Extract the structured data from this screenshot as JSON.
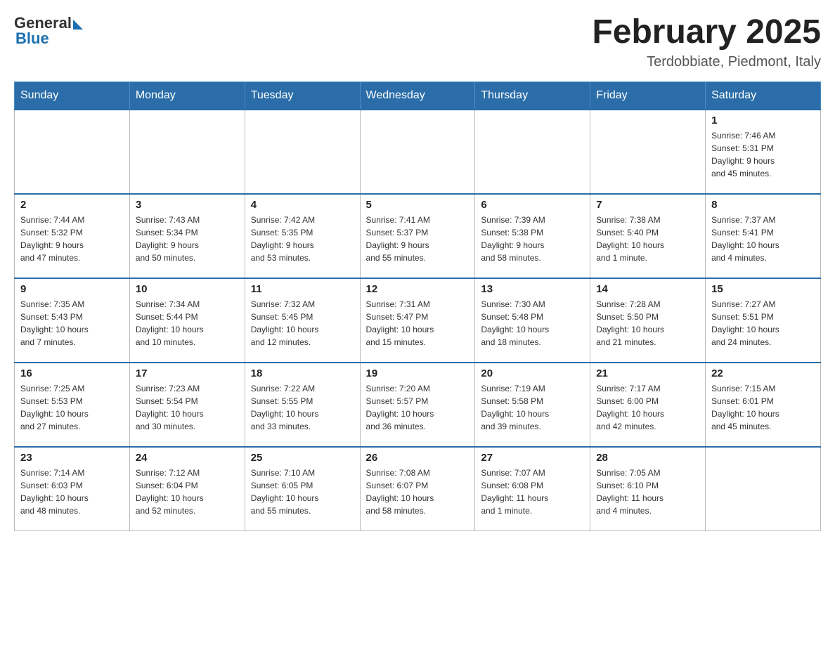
{
  "header": {
    "logo_general": "General",
    "logo_blue": "Blue",
    "month_title": "February 2025",
    "location": "Terdobbiate, Piedmont, Italy"
  },
  "days_of_week": [
    "Sunday",
    "Monday",
    "Tuesday",
    "Wednesday",
    "Thursday",
    "Friday",
    "Saturday"
  ],
  "weeks": [
    [
      {
        "day": "",
        "info": ""
      },
      {
        "day": "",
        "info": ""
      },
      {
        "day": "",
        "info": ""
      },
      {
        "day": "",
        "info": ""
      },
      {
        "day": "",
        "info": ""
      },
      {
        "day": "",
        "info": ""
      },
      {
        "day": "1",
        "info": "Sunrise: 7:46 AM\nSunset: 5:31 PM\nDaylight: 9 hours\nand 45 minutes."
      }
    ],
    [
      {
        "day": "2",
        "info": "Sunrise: 7:44 AM\nSunset: 5:32 PM\nDaylight: 9 hours\nand 47 minutes."
      },
      {
        "day": "3",
        "info": "Sunrise: 7:43 AM\nSunset: 5:34 PM\nDaylight: 9 hours\nand 50 minutes."
      },
      {
        "day": "4",
        "info": "Sunrise: 7:42 AM\nSunset: 5:35 PM\nDaylight: 9 hours\nand 53 minutes."
      },
      {
        "day": "5",
        "info": "Sunrise: 7:41 AM\nSunset: 5:37 PM\nDaylight: 9 hours\nand 55 minutes."
      },
      {
        "day": "6",
        "info": "Sunrise: 7:39 AM\nSunset: 5:38 PM\nDaylight: 9 hours\nand 58 minutes."
      },
      {
        "day": "7",
        "info": "Sunrise: 7:38 AM\nSunset: 5:40 PM\nDaylight: 10 hours\nand 1 minute."
      },
      {
        "day": "8",
        "info": "Sunrise: 7:37 AM\nSunset: 5:41 PM\nDaylight: 10 hours\nand 4 minutes."
      }
    ],
    [
      {
        "day": "9",
        "info": "Sunrise: 7:35 AM\nSunset: 5:43 PM\nDaylight: 10 hours\nand 7 minutes."
      },
      {
        "day": "10",
        "info": "Sunrise: 7:34 AM\nSunset: 5:44 PM\nDaylight: 10 hours\nand 10 minutes."
      },
      {
        "day": "11",
        "info": "Sunrise: 7:32 AM\nSunset: 5:45 PM\nDaylight: 10 hours\nand 12 minutes."
      },
      {
        "day": "12",
        "info": "Sunrise: 7:31 AM\nSunset: 5:47 PM\nDaylight: 10 hours\nand 15 minutes."
      },
      {
        "day": "13",
        "info": "Sunrise: 7:30 AM\nSunset: 5:48 PM\nDaylight: 10 hours\nand 18 minutes."
      },
      {
        "day": "14",
        "info": "Sunrise: 7:28 AM\nSunset: 5:50 PM\nDaylight: 10 hours\nand 21 minutes."
      },
      {
        "day": "15",
        "info": "Sunrise: 7:27 AM\nSunset: 5:51 PM\nDaylight: 10 hours\nand 24 minutes."
      }
    ],
    [
      {
        "day": "16",
        "info": "Sunrise: 7:25 AM\nSunset: 5:53 PM\nDaylight: 10 hours\nand 27 minutes."
      },
      {
        "day": "17",
        "info": "Sunrise: 7:23 AM\nSunset: 5:54 PM\nDaylight: 10 hours\nand 30 minutes."
      },
      {
        "day": "18",
        "info": "Sunrise: 7:22 AM\nSunset: 5:55 PM\nDaylight: 10 hours\nand 33 minutes."
      },
      {
        "day": "19",
        "info": "Sunrise: 7:20 AM\nSunset: 5:57 PM\nDaylight: 10 hours\nand 36 minutes."
      },
      {
        "day": "20",
        "info": "Sunrise: 7:19 AM\nSunset: 5:58 PM\nDaylight: 10 hours\nand 39 minutes."
      },
      {
        "day": "21",
        "info": "Sunrise: 7:17 AM\nSunset: 6:00 PM\nDaylight: 10 hours\nand 42 minutes."
      },
      {
        "day": "22",
        "info": "Sunrise: 7:15 AM\nSunset: 6:01 PM\nDaylight: 10 hours\nand 45 minutes."
      }
    ],
    [
      {
        "day": "23",
        "info": "Sunrise: 7:14 AM\nSunset: 6:03 PM\nDaylight: 10 hours\nand 48 minutes."
      },
      {
        "day": "24",
        "info": "Sunrise: 7:12 AM\nSunset: 6:04 PM\nDaylight: 10 hours\nand 52 minutes."
      },
      {
        "day": "25",
        "info": "Sunrise: 7:10 AM\nSunset: 6:05 PM\nDaylight: 10 hours\nand 55 minutes."
      },
      {
        "day": "26",
        "info": "Sunrise: 7:08 AM\nSunset: 6:07 PM\nDaylight: 10 hours\nand 58 minutes."
      },
      {
        "day": "27",
        "info": "Sunrise: 7:07 AM\nSunset: 6:08 PM\nDaylight: 11 hours\nand 1 minute."
      },
      {
        "day": "28",
        "info": "Sunrise: 7:05 AM\nSunset: 6:10 PM\nDaylight: 11 hours\nand 4 minutes."
      },
      {
        "day": "",
        "info": ""
      }
    ]
  ]
}
